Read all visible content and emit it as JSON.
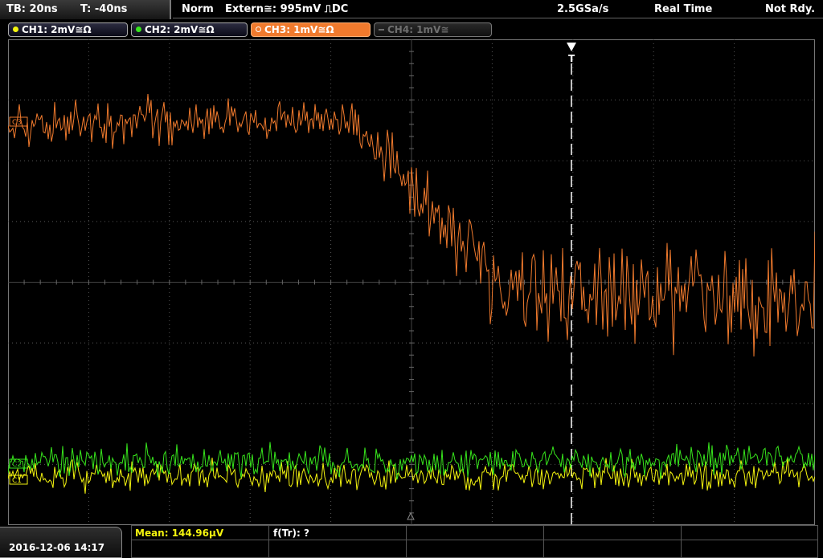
{
  "status": {
    "timebase": "TB: 20ns",
    "trigger_time": "T: -40ns",
    "mode": "Norm",
    "trigger_source": "Extern≅: 995mV ⎍DC",
    "sample_rate": "2.5GSa/s",
    "acq_mode": "Real Time",
    "state": "Not Rdy."
  },
  "channels": [
    {
      "label": "CH1: 2mV≅Ω",
      "color": "#f4f40f"
    },
    {
      "label": "CH2: 2mV≅Ω",
      "color": "#37e51c"
    },
    {
      "label": "CH3: 1mV≅Ω",
      "color": "#f07a2d"
    },
    {
      "label": "CH4: 1mV≅",
      "color": "#6f6f6f"
    }
  ],
  "markers": {
    "ch3": "C3",
    "ch2": "C2",
    "ch1": "C1",
    "trigger": "T"
  },
  "measurements": {
    "mean": "Mean: 144.96µV",
    "ftr": "f(Tr): ?"
  },
  "datetime": "2016-12-06 14:17",
  "icons": {
    "trigger_position": "trigger-arrow-icon",
    "ground_marker": "ground-triangle-icon"
  },
  "colors": {
    "grid": "#555555",
    "trigger_line": "#ffffff",
    "ch3_trace": "#f07a2d",
    "ch2_trace": "#37e51c",
    "ch1_trace": "#f4f40f"
  }
}
